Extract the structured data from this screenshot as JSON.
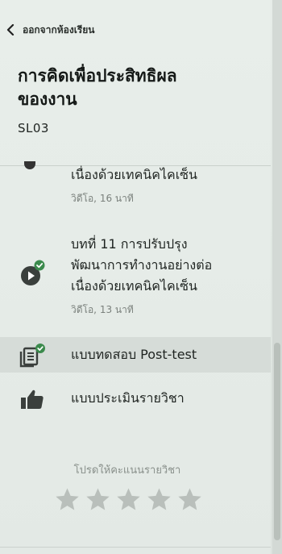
{
  "nav": {
    "back_label": "ออกจากห้องเรียน"
  },
  "course": {
    "title_line1": "การคิดเพื่อประสิทธิผล",
    "title_line2": "ของงาน",
    "code": "SL03"
  },
  "lessons": [
    {
      "title_tail": "เนื่องด้วยเทคนิคไคเซ็น",
      "meta": "วิดีโอ, 16 นาที"
    },
    {
      "title_lines": [
        "บทที่ 11 การปรับปรุง",
        "พัฒนาการทำงานอย่างต่อ",
        "เนื่องด้วยเทคนิคไคเซ็น"
      ],
      "meta": "วิดีโอ, 13 นาที",
      "icon": "play-circle-icon",
      "completed": true
    }
  ],
  "items": [
    {
      "label": "แบบทดสอบ Post-test",
      "icon": "document-list-icon",
      "completed": true,
      "active": true
    },
    {
      "label": "แบบประเมินรายวิชา",
      "icon": "thumbs-up-icon",
      "completed": false,
      "active": false
    }
  ],
  "rating": {
    "prompt": "โปรดให้คะแนนรายวิชา",
    "stars": 5,
    "value": 0
  },
  "colors": {
    "accent_green": "#3b8a4c",
    "icon_dark": "#3a3f3c",
    "star_empty": "#b9bfbb"
  }
}
